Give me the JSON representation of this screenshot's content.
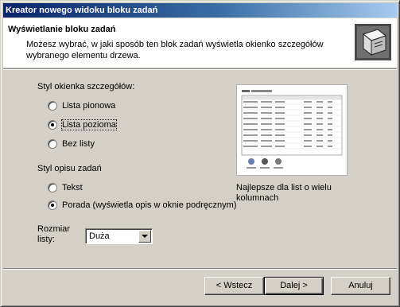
{
  "window": {
    "title": "Kreator nowego widoku bloku zadań",
    "close_glyph": "×"
  },
  "header": {
    "title": "Wyświetlanie bloku zadań",
    "description": "Możesz wybrać, w jaki sposób ten blok zadań wyświetla okienko szczegółów wybranego elementu drzewa.",
    "icon": "wizard-graphic-icon"
  },
  "details_style": {
    "label": "Styl okienka szczegółów:",
    "options": [
      "Lista pionowa",
      "Lista pozioma",
      "Bez listy"
    ],
    "selected": "Lista pozioma"
  },
  "description_style": {
    "label": "Styl opisu zadań",
    "options": [
      "Tekst",
      "Porada (wyświetla opis w oknie podręcznym)"
    ],
    "selected": "Porada (wyświetla opis w oknie podręcznym)"
  },
  "list_size": {
    "label_line1": "Rozmiar",
    "label_line2": "listy:",
    "value": "Duża"
  },
  "preview": {
    "description": "Najlepsze dla list o wielu kolumnach"
  },
  "buttons": {
    "back": "< Wstecz",
    "next": "Dalej >",
    "cancel": "Anuluj"
  },
  "colors": {
    "title_start": "#0a246a",
    "title_end": "#a6caf0",
    "face": "#d4d0c8"
  }
}
